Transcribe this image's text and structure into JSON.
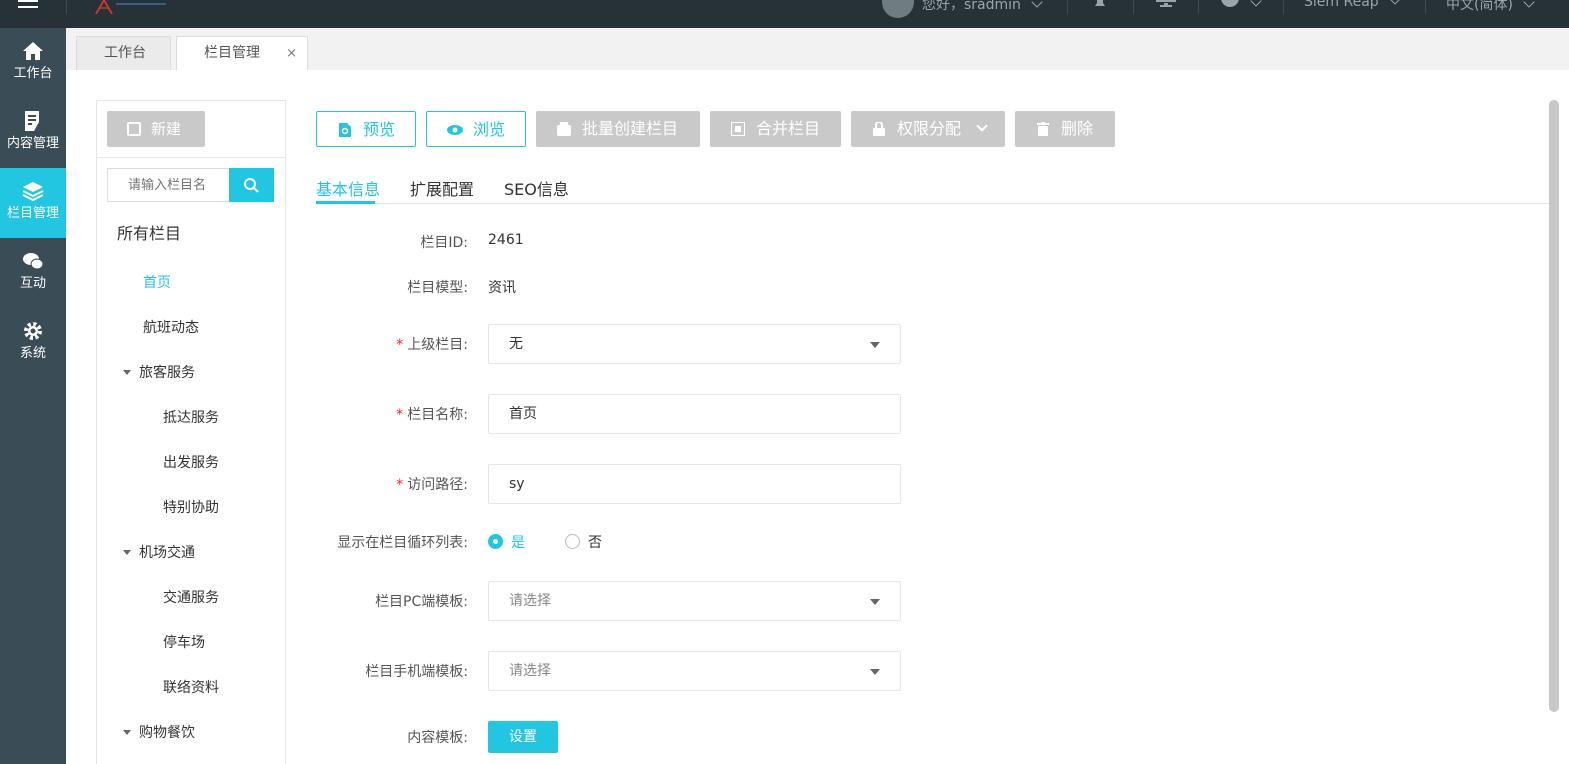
{
  "topbar": {
    "greeting": "您好，sradmin",
    "site": "Siem Reap",
    "language": "中文(简体)"
  },
  "sidenav": {
    "items": [
      {
        "label": "工作台",
        "icon": "home-icon"
      },
      {
        "label": "内容管理",
        "icon": "document-edit-icon"
      },
      {
        "label": "栏目管理",
        "icon": "layers-icon",
        "active": true
      },
      {
        "label": "互动",
        "icon": "chat-icon"
      },
      {
        "label": "系统",
        "icon": "gear-icon"
      }
    ]
  },
  "tabs": [
    {
      "label": "工作台"
    },
    {
      "label": "栏目管理",
      "close": "×",
      "active": true
    }
  ],
  "tree": {
    "new_label": "新建",
    "search_placeholder": "请输入栏目名",
    "title": "所有栏目",
    "nodes": [
      {
        "label": "首页",
        "active": true
      },
      {
        "label": "航班动态"
      },
      {
        "label": "旅客服务",
        "expanded": true
      },
      {
        "label": "抵达服务"
      },
      {
        "label": "出发服务"
      },
      {
        "label": "特别协助"
      },
      {
        "label": "机场交通",
        "expanded": true
      },
      {
        "label": "交通服务"
      },
      {
        "label": "停车场"
      },
      {
        "label": "联络资料"
      },
      {
        "label": "购物餐饮",
        "expanded": true
      }
    ]
  },
  "toolbar": {
    "preview": "预览",
    "browse": "浏览",
    "batch_create": "批量创建栏目",
    "merge": "合并栏目",
    "permissions": "权限分配",
    "delete": "删除"
  },
  "subtabs": [
    {
      "label": "基本信息",
      "active": true
    },
    {
      "label": "扩展配置"
    },
    {
      "label": "SEO信息"
    }
  ],
  "form": {
    "id_label": "栏目ID:",
    "id_value": "2461",
    "model_label": "栏目模型:",
    "model_value": "资讯",
    "parent_label": "上级栏目:",
    "parent_value": "无",
    "name_label": "栏目名称:",
    "name_value": "首页",
    "path_label": "访问路径:",
    "path_value": "sy",
    "show_label": "显示在栏目循环列表:",
    "show_yes": "是",
    "show_no": "否",
    "show_selected": "是",
    "pc_tpl_label": "栏目PC端模板:",
    "pc_tpl_placeholder": "请选择",
    "mobile_tpl_label": "栏目手机端模板:",
    "mobile_tpl_placeholder": "请选择",
    "content_tpl_label": "内容模板:",
    "content_tpl_button": "设置",
    "required_mark": "*"
  },
  "colors": {
    "accent": "#23c6e0",
    "topbar": "#263238",
    "sidenav": "#3a4c55",
    "disabled": "#c9c9c9",
    "required": "#f5222d"
  }
}
